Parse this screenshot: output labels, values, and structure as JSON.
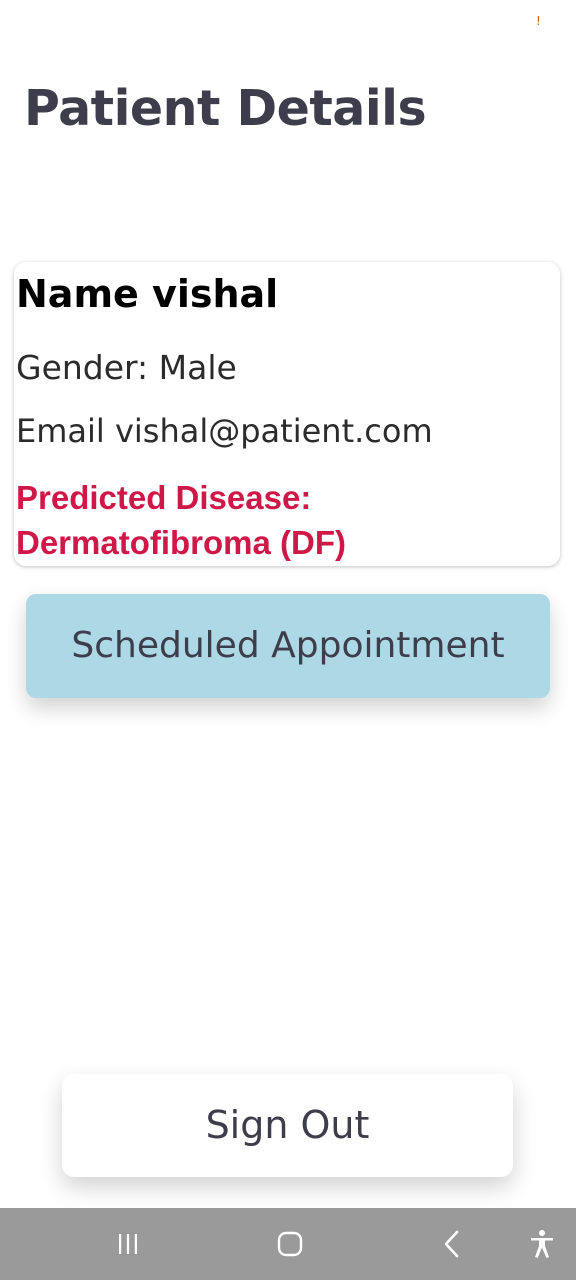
{
  "status_bar": {
    "alert_mark": "!"
  },
  "page": {
    "title": "Patient Details"
  },
  "patient_card": {
    "name_line": "Name vishal",
    "gender_line": "Gender: Male",
    "email_line": "Email vishal@patient.com",
    "disease_label": "Predicted Disease:",
    "disease_value": "Dermatofibroma (DF)"
  },
  "actions": {
    "appointment_label": "Scheduled Appointment",
    "signout_label": "Sign Out"
  },
  "nav_bar": {
    "icons": [
      "recent-apps-icon",
      "home-icon",
      "back-icon",
      "accessibility-icon"
    ]
  },
  "colors": {
    "title": "#3d3d4b",
    "disease": "#d01848",
    "appointment_bg": "#add8e6",
    "navbar_bg": "#9a9a9a"
  }
}
